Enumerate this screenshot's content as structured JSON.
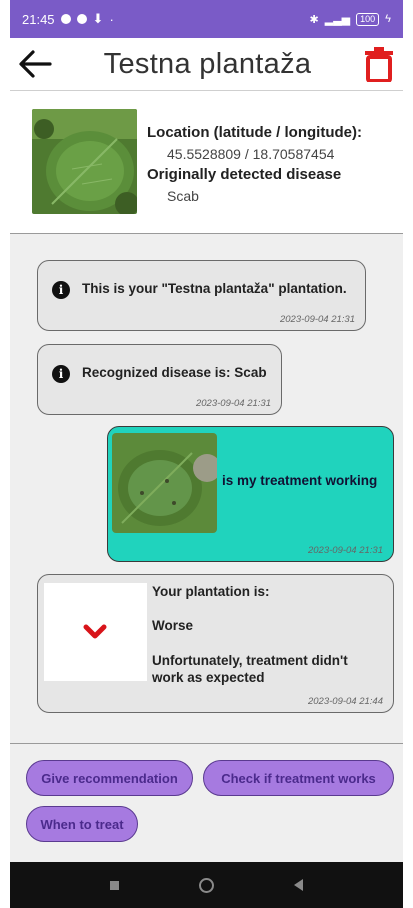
{
  "status": {
    "time": "21:45",
    "battery": "100"
  },
  "appbar": {
    "title": "Testna plantaža"
  },
  "info": {
    "location_label": "Location (latitude / longitude):",
    "location_value": "45.5528809 / 18.70587454",
    "disease_label": "Originally detected disease",
    "disease_value": "Scab"
  },
  "messages": [
    {
      "text": "This is your \"Testna plantaža\" plantation.",
      "timestamp": "2023-09-04 21:31"
    },
    {
      "text": "Recognized disease is: Scab",
      "timestamp": "2023-09-04 21:31"
    },
    {
      "text": "is my treatment working",
      "timestamp": "2023-09-04 21:31"
    },
    {
      "line1": "Your plantation is:",
      "line2": "Worse",
      "line3": "Unfortunately, treatment didn't work as expected",
      "timestamp": "2023-09-04 21:44"
    }
  ],
  "controls": {
    "give_recommendation": "Give recommendation",
    "check_treatment": "Check if treatment works",
    "when_to_treat": "When to treat"
  },
  "colors": {
    "accent": "#7a5bc7",
    "user_bubble": "#20d3bd",
    "pill": "#a67ae0",
    "danger": "#e01f1f"
  }
}
